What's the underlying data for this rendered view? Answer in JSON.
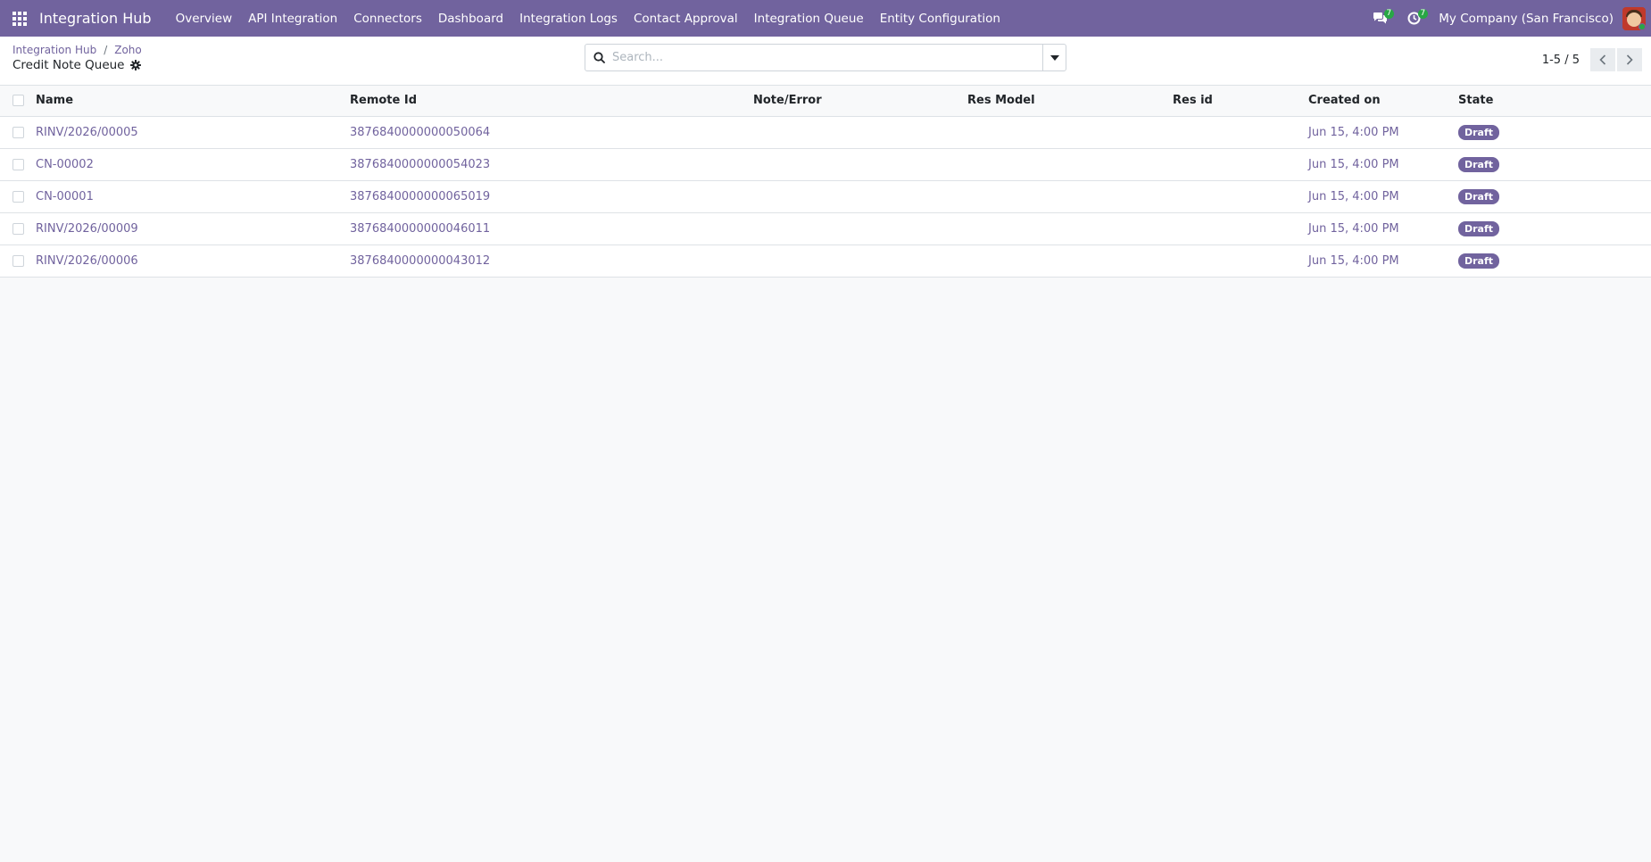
{
  "navbar": {
    "brand": "Integration Hub",
    "menu": [
      "Overview",
      "API Integration",
      "Connectors",
      "Dashboard",
      "Integration Logs",
      "Contact Approval",
      "Integration Queue",
      "Entity Configuration"
    ],
    "messages_count": "7",
    "activities_count": "7",
    "company": "My Company (San Francisco)"
  },
  "breadcrumb": {
    "root": "Integration Hub",
    "separator": "/",
    "current": "Zoho"
  },
  "page_title": "Credit Note Queue",
  "search": {
    "placeholder": "Search...",
    "value": ""
  },
  "pager": {
    "value": "1-5 / 5"
  },
  "table": {
    "columns": [
      "Name",
      "Remote Id",
      "Note/Error",
      "Res Model",
      "Res id",
      "Created on",
      "State"
    ],
    "rows": [
      {
        "name": "RINV/2026/00005",
        "remote_id": "3876840000000050064",
        "note": "",
        "res_model": "",
        "res_id": "",
        "created_on": "Jun 15, 4:00 PM",
        "state": "Draft"
      },
      {
        "name": "CN-00002",
        "remote_id": "3876840000000054023",
        "note": "",
        "res_model": "",
        "res_id": "",
        "created_on": "Jun 15, 4:00 PM",
        "state": "Draft"
      },
      {
        "name": "CN-00001",
        "remote_id": "3876840000000065019",
        "note": "",
        "res_model": "",
        "res_id": "",
        "created_on": "Jun 15, 4:00 PM",
        "state": "Draft"
      },
      {
        "name": "RINV/2026/00009",
        "remote_id": "3876840000000046011",
        "note": "",
        "res_model": "",
        "res_id": "",
        "created_on": "Jun 15, 4:00 PM",
        "state": "Draft"
      },
      {
        "name": "RINV/2026/00006",
        "remote_id": "3876840000000043012",
        "note": "",
        "res_model": "",
        "res_id": "",
        "created_on": "Jun 15, 4:00 PM",
        "state": "Draft"
      }
    ]
  },
  "colors": {
    "brand": "#71639e",
    "badge_bg": "#71639e",
    "notify_badge": "#28a745"
  },
  "icons": {
    "apps": "apps-grid-icon",
    "messages": "chat-icon",
    "activities": "clock-icon",
    "settings": "gear-icon",
    "search": "search-icon",
    "dropdown": "caret-down-icon",
    "prev": "chevron-left-icon",
    "next": "chevron-right-icon"
  }
}
